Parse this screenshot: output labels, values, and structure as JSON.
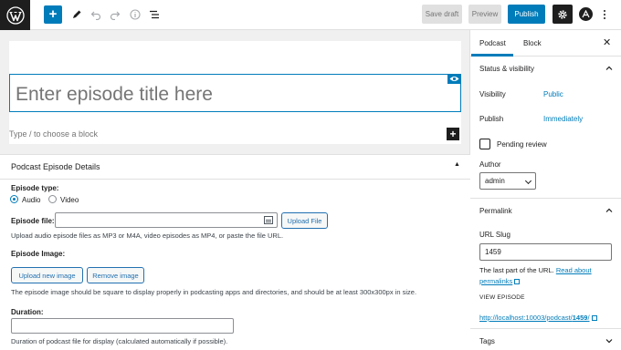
{
  "toolbar": {
    "save_draft_label": "Save draft",
    "preview_label": "Preview",
    "publish_label": "Publish",
    "add_symbol": "+",
    "accent_color": "#007cba"
  },
  "editor": {
    "title_placeholder": "Enter episode title here",
    "appender_placeholder": "Type / to choose a block"
  },
  "metabox": {
    "title": "Podcast Episode Details",
    "toggle_glyph": "▲",
    "episode_type_label": "Episode type:",
    "episode_type_options": [
      "Audio",
      "Video"
    ],
    "episode_type_selected": "Audio",
    "episode_file_label": "Episode file:",
    "upload_file_label": "Upload File",
    "episode_file_help": "Upload audio episode files as MP3 or M4A, video episodes as MP4, or paste the file URL.",
    "episode_image_label": "Episode Image:",
    "upload_image_label": "Upload new image",
    "remove_image_label": "Remove image",
    "episode_image_help": "The episode image should be square to display properly in podcasting apps and directories, and should be at least 300x300px in size.",
    "duration_label": "Duration:",
    "duration_help": "Duration of podcast file for display (calculated automatically if possible)."
  },
  "sidebar": {
    "tabs": [
      {
        "label": "Podcast",
        "active": true
      },
      {
        "label": "Block",
        "active": false
      }
    ],
    "close_symbol": "✕",
    "status_visibility": {
      "title": "Status & visibility",
      "visibility_label": "Visibility",
      "visibility_value": "Public",
      "publish_label": "Publish",
      "publish_value": "Immediately",
      "pending_review_label": "Pending review",
      "pending_review_checked": false,
      "author_label": "Author",
      "author_value": "admin"
    },
    "permalink": {
      "title": "Permalink",
      "url_slug_label": "URL Slug",
      "url_slug_value": "1459",
      "help_text": "The last part of the URL.",
      "help_link": "Read about",
      "help_link_2": "permalinks",
      "view_episode_label": "VIEW EPISODE",
      "url_prefix": "http://localhost:10003/podcast/",
      "url_slug_bold": "1459",
      "url_suffix": "/"
    },
    "tags": {
      "title": "Tags"
    }
  }
}
